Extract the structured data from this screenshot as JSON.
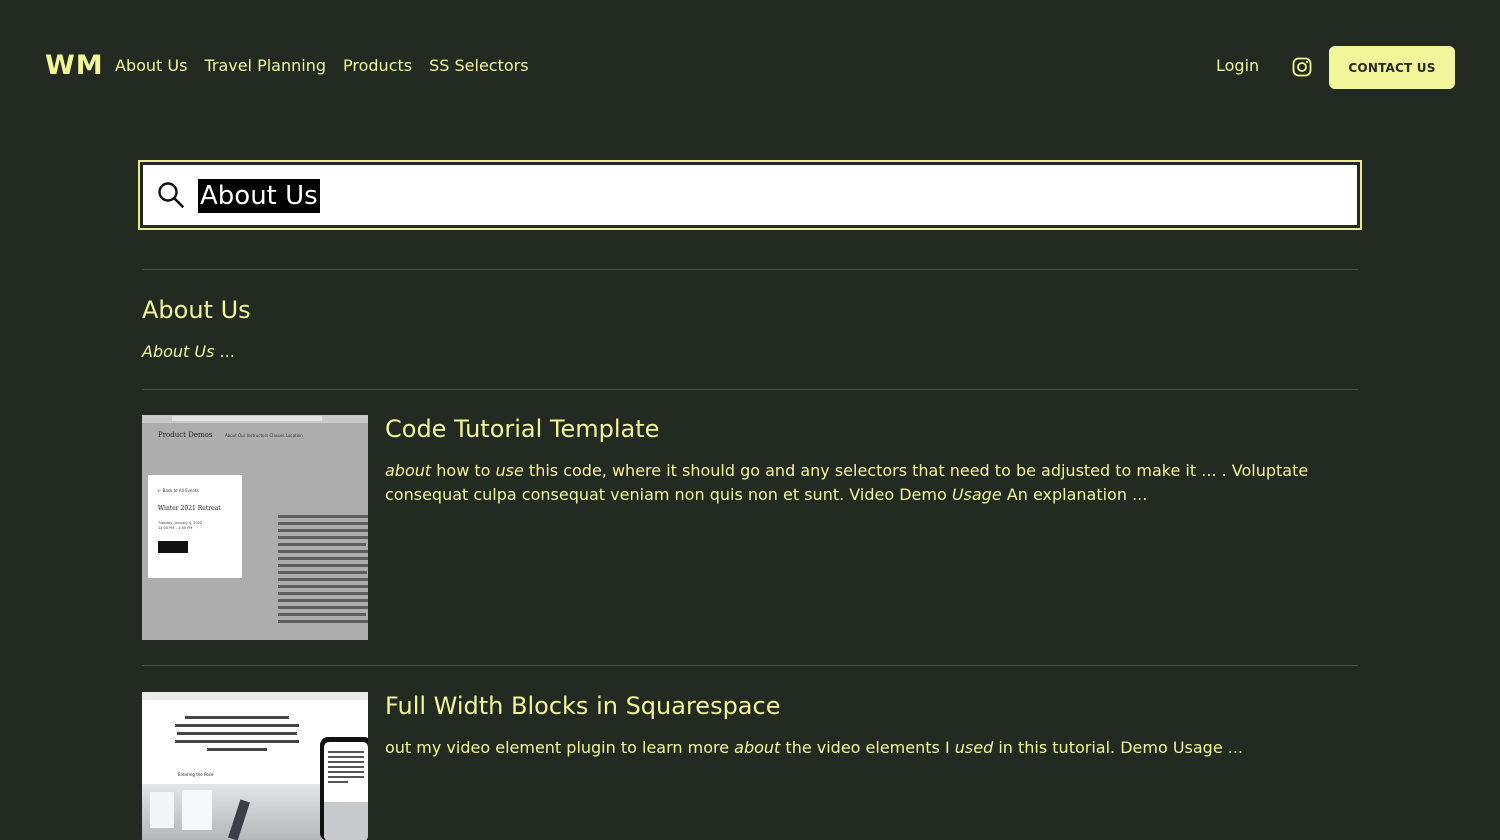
{
  "header": {
    "logo": "WM",
    "nav": [
      "About Us",
      "Travel Planning",
      "Products",
      "SS Selectors"
    ],
    "login": "Login",
    "contact": "CONTACT US"
  },
  "search": {
    "value": "About Us"
  },
  "results": [
    {
      "title": "About Us",
      "excerpt_parts": [
        {
          "text": "About Us",
          "em": true
        },
        {
          "text": " ...",
          "em": false
        }
      ]
    },
    {
      "title": "Code Tutorial Template",
      "excerpt_parts": [
        {
          "text": "about",
          "em": true
        },
        {
          "text": " how to ",
          "em": false
        },
        {
          "text": "use",
          "em": true
        },
        {
          "text": " this code, where it should go and any selectors that need to be adjusted to make it ... . Voluptate consequat culpa consequat veniam non quis non et sunt. Video Demo ",
          "em": false
        },
        {
          "text": "Usage",
          "em": true
        },
        {
          "text": " An explanation ...",
          "em": false
        }
      ],
      "thumb": {
        "brand": "Product Demos",
        "menu": "About   Our Instructors   Classes   Location",
        "back": "← Back to All Events",
        "event": "Winter 2021 Retreat",
        "date": "Tuesday, January 4, 2022",
        "time": "12:00 PM – 1:00 PM"
      }
    },
    {
      "title": "Full Width Blocks in Squarespace",
      "excerpt_parts": [
        {
          "text": "out my video element plugin to learn more ",
          "em": false
        },
        {
          "text": "about",
          "em": true
        },
        {
          "text": " the video elements I ",
          "em": false
        },
        {
          "text": "used",
          "em": true
        },
        {
          "text": " in this tutorial. Demo Usage ...",
          "em": false
        }
      ],
      "thumb": {
        "label": "Entering the Pose"
      }
    }
  ],
  "colors": {
    "background": "#232a21",
    "accent": "#f3f59a"
  }
}
